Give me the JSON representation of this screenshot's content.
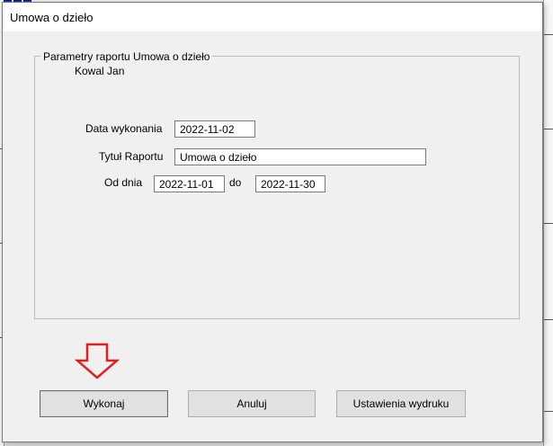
{
  "dialog": {
    "title": "Umowa o dzieło"
  },
  "group": {
    "legend": "Parametry raportu  Umowa o dzieło",
    "person": "Kowal Jan"
  },
  "form": {
    "date_label": "Data wykonania",
    "date_value": "2022-11-02",
    "title_label": "Tytuł Raportu",
    "title_value": "Umowa o dzieło",
    "from_label": "Od dnia",
    "from_value": "2022-11-01",
    "to_label": "do",
    "to_value": "2022-11-30"
  },
  "buttons": {
    "run": "Wykonaj",
    "cancel": "Anuluj",
    "print_settings": "Ustawienia wydruku"
  },
  "colors": {
    "arrow": "#e02020",
    "background": "#f0f0f0"
  }
}
